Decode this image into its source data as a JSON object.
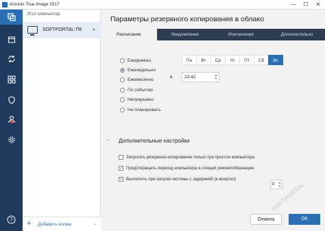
{
  "window": {
    "title": "Acronis True Image 2017",
    "minimize_glyph": "—",
    "maximize_glyph": "☐",
    "close_glyph": "✕"
  },
  "nav": {
    "icons": [
      "backup-icon",
      "archive-icon",
      "sync-icon",
      "tools-icon",
      "shield-icon",
      "account-icon",
      "settings-icon",
      "help-icon"
    ],
    "help_glyph": "?"
  },
  "sidebar": {
    "header": "Этот компьютер",
    "machine_name": "SOFTPORTAL-ПК",
    "machine_arrow": "▸",
    "add_label": "Добавить копию",
    "add_glyph": "+",
    "footer_chevron": "⌄"
  },
  "main": {
    "heading": "Параметры резервного копирования в облако",
    "tabs": [
      "Расписание",
      "Уведомления",
      "Исключения",
      "Дополнительно"
    ],
    "schedule_options": [
      "Ежедневно",
      "Еженедельно",
      "Ежемесячно",
      "По событию",
      "Непрерывно",
      "Не планировать"
    ],
    "selected_option": "Еженедельно",
    "days": [
      "Пн",
      "Вт",
      "Ср",
      "Чт",
      "Пт",
      "Сб",
      "Вс"
    ],
    "selected_day": "Вс",
    "time_prefix": "в",
    "time_value": "22:42",
    "advanced_title": "Дополнительные настройки",
    "advanced_toggle": "⌃",
    "advanced_checks": [
      {
        "label": "Запускать резервное копирование только при простое компьютера",
        "checked": false
      },
      {
        "label": "Предотвращать переход компьютера в спящий режим/гибернацию",
        "checked": true
      },
      {
        "label": "Выполнять при запуске системы с задержкой (в минутах)",
        "checked": true
      }
    ],
    "delay_value": "0",
    "cancel_label": "Отмена",
    "ok_label": "ОК"
  },
  "watermark": "SOFTPORTAL",
  "colors": {
    "accent": "#2a6fb3",
    "nav_bg": "#1e3a5c",
    "tabs_bg": "#2e3e52"
  }
}
